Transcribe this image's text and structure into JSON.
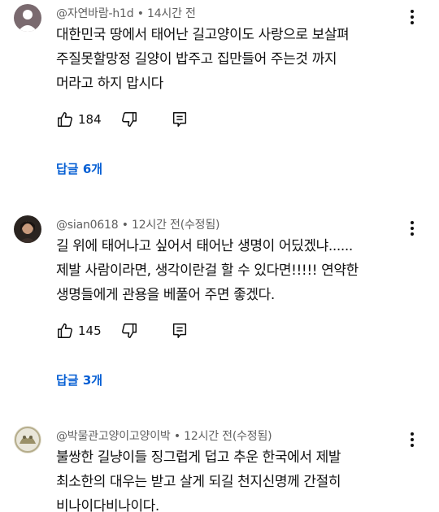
{
  "comments": [
    {
      "meta": "@자연바람-h1d • 14시간 전",
      "lines": [
        "대한민국 땅에서 태어난 길고양이도 사랑으로 보살펴",
        "주질못할망정 길양이 밥주고 집만들어 주는것 까지",
        "머라고 하지 맙시다"
      ],
      "likes": "184",
      "replies": "답글 6개"
    },
    {
      "meta": "@sian0618 • 12시간 전(수정됨)",
      "lines": [
        "길 위에 태어나고 싶어서 태어난 생명이 어딨겠냐......",
        "제발 사람이라면, 생각이란걸 할 수 있다면!!!!! 연약한",
        "생명들에게 관용을 베풀어 주면 좋겠다."
      ],
      "likes": "145",
      "replies": "답글 3개"
    },
    {
      "meta": "@박물관고양이고양이박 • 12시간 전(수정됨)",
      "lines": [
        "불쌍한 길냥이들 징그럽게 덥고 추운 한국에서 제발",
        "최소한의 대우는 받고 살게 되길 천지신명께 간절히",
        "비나이다비나이다."
      ]
    }
  ],
  "icons": {
    "like": "thumbs-up-icon",
    "dislike": "thumbs-down-icon",
    "reply": "reply-comment-icon",
    "more": "more-vertical-icon"
  },
  "colors": {
    "link": "#065fd4",
    "meta": "#606060",
    "text": "#0f0f0f"
  }
}
